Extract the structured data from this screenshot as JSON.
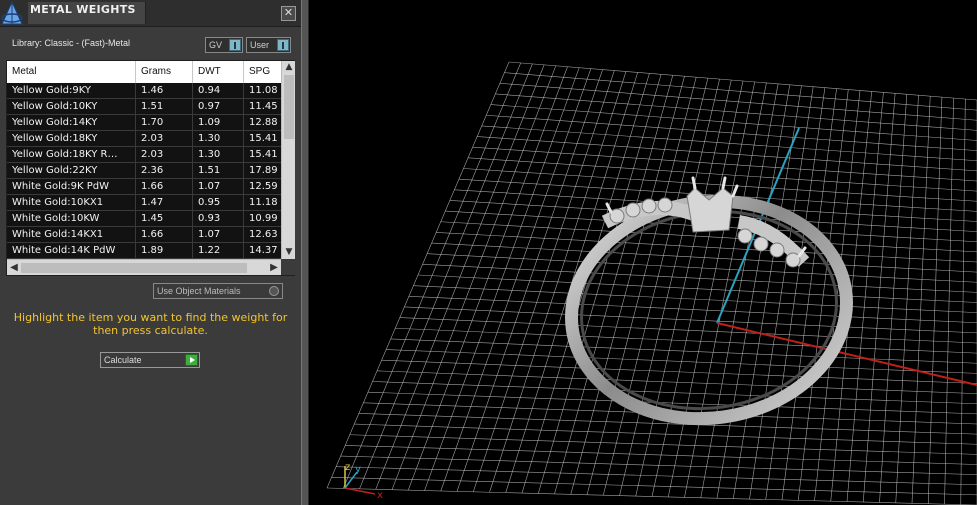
{
  "panel": {
    "title": "METAL WEIGHTS",
    "close_glyph": "✕",
    "library_label": "Library: Classic - (Fast)-Metal",
    "dropdown_gv": "GV",
    "dropdown_user": "User",
    "columns": [
      "Metal",
      "Grams",
      "DWT",
      "SPG"
    ],
    "rows": [
      {
        "metal": "Yellow Gold:9KY",
        "grams": "1.46",
        "dwt": "0.94",
        "spg": "11.08"
      },
      {
        "metal": "Yellow Gold:10KY",
        "grams": "1.51",
        "dwt": "0.97",
        "spg": "11.45"
      },
      {
        "metal": "Yellow Gold:14KY",
        "grams": "1.70",
        "dwt": "1.09",
        "spg": "12.88"
      },
      {
        "metal": "Yellow Gold:18KY",
        "grams": "2.03",
        "dwt": "1.30",
        "spg": "15.41"
      },
      {
        "metal": "Yellow Gold:18KY R…",
        "grams": "2.03",
        "dwt": "1.30",
        "spg": "15.41"
      },
      {
        "metal": "Yellow Gold:22KY",
        "grams": "2.36",
        "dwt": "1.51",
        "spg": "17.89"
      },
      {
        "metal": "White Gold:9K PdW",
        "grams": "1.66",
        "dwt": "1.07",
        "spg": "12.59"
      },
      {
        "metal": "White Gold:10KX1",
        "grams": "1.47",
        "dwt": "0.95",
        "spg": "11.18"
      },
      {
        "metal": "White Gold:10KW",
        "grams": "1.45",
        "dwt": "0.93",
        "spg": "10.99"
      },
      {
        "metal": "White Gold:14KX1",
        "grams": "1.66",
        "dwt": "1.07",
        "spg": "12.63"
      },
      {
        "metal": "White Gold:14K PdW",
        "grams": "1.89",
        "dwt": "1.22",
        "spg": "14.37"
      }
    ],
    "use_object_materials": "Use Object Materials",
    "hint": "Highlight the item you want to find the weight for then press calculate.",
    "calculate_label": "Calculate"
  },
  "viewport": {
    "axis_gizmo": {
      "z": "z",
      "y": "y",
      "x": "x"
    },
    "colors": {
      "grid": "#bfbfbf",
      "axis_x": "#c0201a",
      "axis_y": "#2aa2c0",
      "ring": "#b8b8b8"
    }
  }
}
